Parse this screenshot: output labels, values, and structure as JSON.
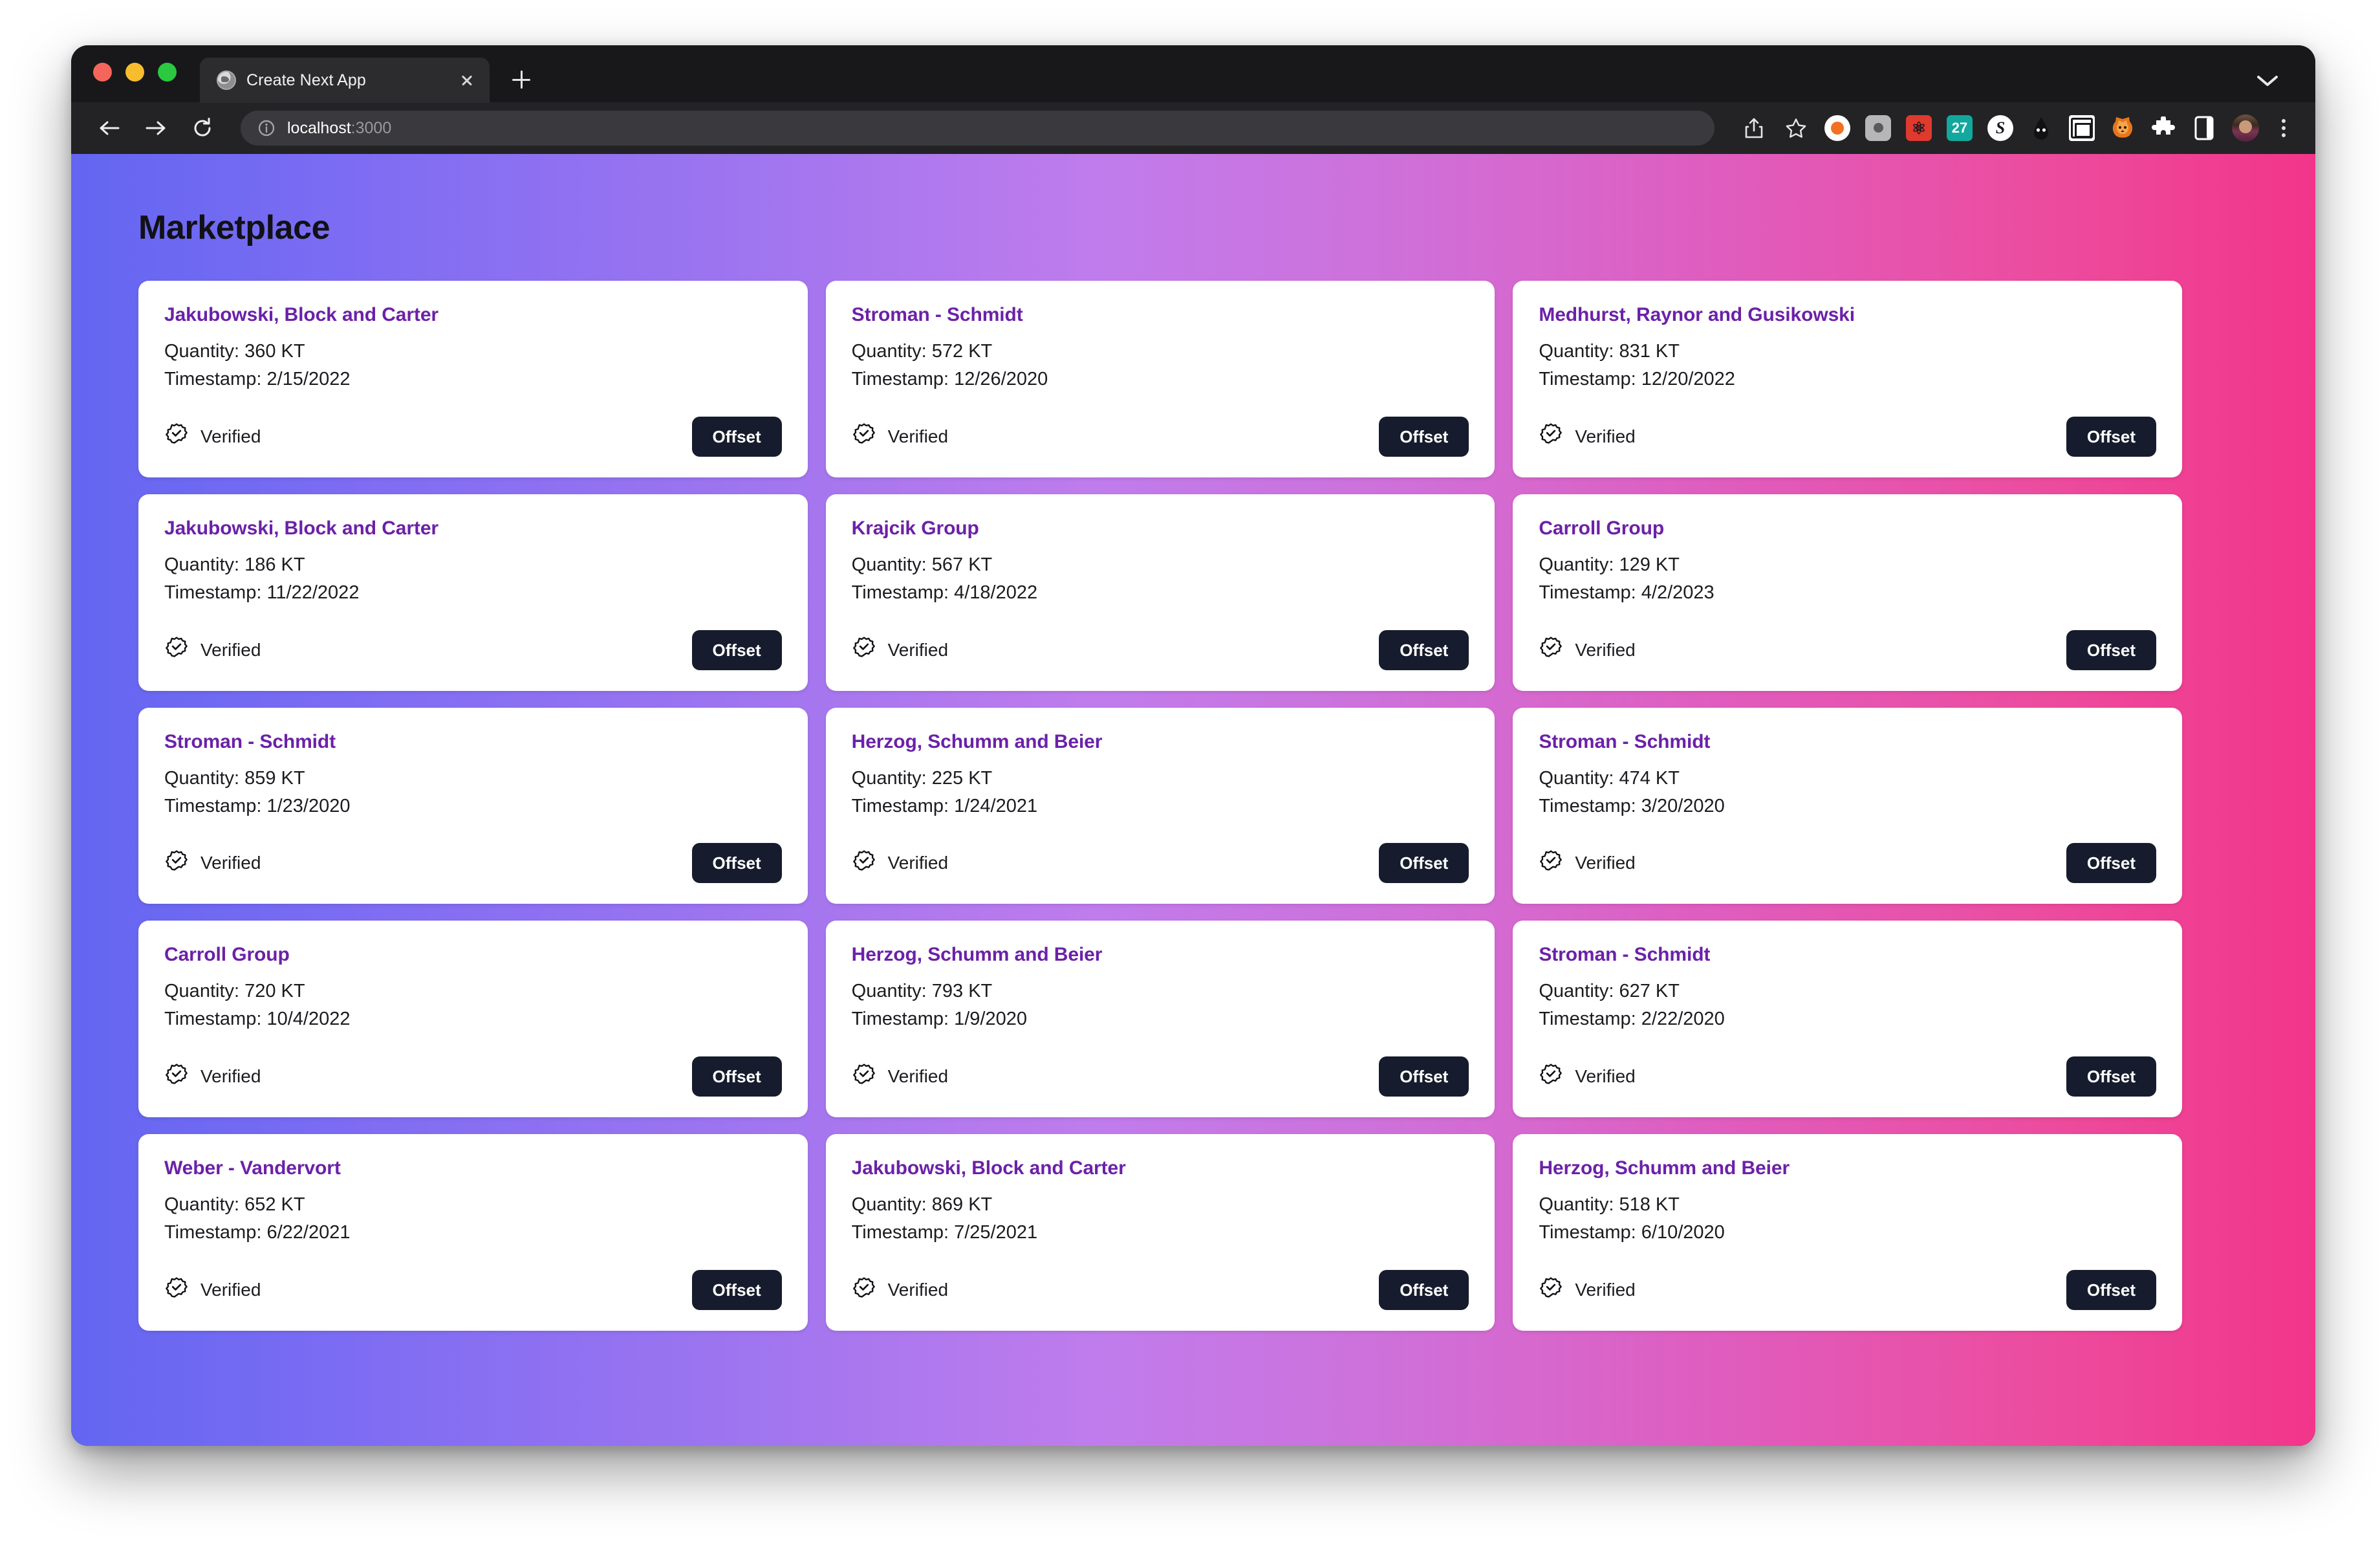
{
  "browser": {
    "tab": {
      "title": "Create Next App",
      "favicon_icon": "globe-icon",
      "close_icon": "close-icon"
    },
    "new_tab_icon": "plus-icon",
    "tab_strip_chevron_icon": "chevron-down-icon",
    "nav": {
      "back_icon": "arrow-left-icon",
      "forward_icon": "arrow-right-icon",
      "reload_icon": "reload-icon"
    },
    "omnibox": {
      "info_icon": "info-circle-icon",
      "host": "localhost",
      "port": ":3000"
    },
    "toolbar_icons": [
      "share-icon",
      "star-icon",
      "bitwarden-extension-icon",
      "camera-extension-icon",
      "react-devtools-extension-icon",
      "calendar-27-extension-icon",
      "grammarly-extension-icon",
      "eyedropper-extension-icon",
      "window-frame-extension-icon",
      "firefox-relay-extension-icon",
      "puzzle-extensions-icon",
      "side-panel-icon",
      "profile-avatar",
      "kebab-menu-icon"
    ],
    "calendar_badge_text": "27"
  },
  "page": {
    "title": "Marketplace",
    "verified_label": "Verified",
    "verified_icon": "verified-badge-icon",
    "offset_label": "Offset",
    "quantity_prefix": "Quantity: ",
    "timestamp_prefix": "Timestamp: ",
    "quantity_unit": " KT",
    "accent_title_color": "#6b21a8",
    "button_color": "#161c2d",
    "gradient_start": "#6366f1",
    "gradient_end": "#f2358a",
    "cards": [
      {
        "name": "Jakubowski, Block and Carter",
        "quantity": "Quantity: 360 KT",
        "timestamp": "Timestamp: 2/15/2022"
      },
      {
        "name": "Stroman - Schmidt",
        "quantity": "Quantity: 572 KT",
        "timestamp": "Timestamp: 12/26/2020"
      },
      {
        "name": "Medhurst, Raynor and Gusikowski",
        "quantity": "Quantity: 831 KT",
        "timestamp": "Timestamp: 12/20/2022"
      },
      {
        "name": "Jakubowski, Block and Carter",
        "quantity": "Quantity: 186 KT",
        "timestamp": "Timestamp: 11/22/2022"
      },
      {
        "name": "Krajcik Group",
        "quantity": "Quantity: 567 KT",
        "timestamp": "Timestamp: 4/18/2022"
      },
      {
        "name": "Carroll Group",
        "quantity": "Quantity: 129 KT",
        "timestamp": "Timestamp: 4/2/2023"
      },
      {
        "name": "Stroman - Schmidt",
        "quantity": "Quantity: 859 KT",
        "timestamp": "Timestamp: 1/23/2020"
      },
      {
        "name": "Herzog, Schumm and Beier",
        "quantity": "Quantity: 225 KT",
        "timestamp": "Timestamp: 1/24/2021"
      },
      {
        "name": "Stroman - Schmidt",
        "quantity": "Quantity: 474 KT",
        "timestamp": "Timestamp: 3/20/2020"
      },
      {
        "name": "Carroll Group",
        "quantity": "Quantity: 720 KT",
        "timestamp": "Timestamp: 10/4/2022"
      },
      {
        "name": "Herzog, Schumm and Beier",
        "quantity": "Quantity: 793 KT",
        "timestamp": "Timestamp: 1/9/2020"
      },
      {
        "name": "Stroman - Schmidt",
        "quantity": "Quantity: 627 KT",
        "timestamp": "Timestamp: 2/22/2020"
      },
      {
        "name": "Weber - Vandervort",
        "quantity": "Quantity: 652 KT",
        "timestamp": "Timestamp: 6/22/2021"
      },
      {
        "name": "Jakubowski, Block and Carter",
        "quantity": "Quantity: 869 KT",
        "timestamp": "Timestamp: 7/25/2021"
      },
      {
        "name": "Herzog, Schumm and Beier",
        "quantity": "Quantity: 518 KT",
        "timestamp": "Timestamp: 6/10/2020"
      }
    ]
  }
}
